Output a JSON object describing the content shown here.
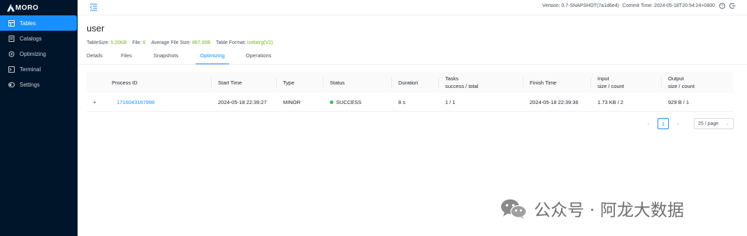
{
  "app": {
    "logo_text": "MORO"
  },
  "sidebar": {
    "items": [
      {
        "label": "Tables",
        "icon": "table-icon",
        "active": true
      },
      {
        "label": "Catalogs",
        "icon": "catalog-icon",
        "active": false
      },
      {
        "label": "Optimizing",
        "icon": "optimizing-icon",
        "active": false
      },
      {
        "label": "Terminal",
        "icon": "terminal-icon",
        "active": false
      },
      {
        "label": "Settings",
        "icon": "settings-icon",
        "active": false
      }
    ]
  },
  "header": {
    "version_label": "Version: 0.7-SNAPSHOT(7a1d6e4)",
    "commit_label": "Commit Time: 2024-05-18T20:54:24+0800"
  },
  "page": {
    "title": "user",
    "meta": {
      "table_size_label": "TableSize:",
      "table_size_value": "5.20KB",
      "file_label": "File:",
      "file_value": "6",
      "avg_file_size_label": "Average File Size:",
      "avg_file_size_value": "887.00B",
      "table_format_label": "Table Format:",
      "table_format_value": "Iceberg(V2)"
    },
    "tabs": [
      {
        "label": "Details",
        "active": false
      },
      {
        "label": "Files",
        "active": false
      },
      {
        "label": "Snapshots",
        "active": false
      },
      {
        "label": "Optimizing",
        "active": true
      },
      {
        "label": "Operations",
        "active": false
      }
    ]
  },
  "table": {
    "columns": {
      "process_id": "Process ID",
      "start_time": "Start Time",
      "type": "Type",
      "status": "Status",
      "duration": "Duration",
      "tasks_line1": "Tasks",
      "tasks_line2": "success / total",
      "finish_time": "Finish Time",
      "input_line1": "Input",
      "input_line2": "size / count",
      "output_line1": "Output",
      "output_line2": "size / count"
    },
    "rows": [
      {
        "expand": "+",
        "process_id": "1716043167998",
        "start_time": "2024-05-18 22:39:27",
        "type": "MINOR",
        "status": "SUCCESS",
        "status_color": "#2fc25b",
        "duration": "8 s",
        "tasks": "1 / 1",
        "finish_time": "2024-05-18 22:39:36",
        "input": "1.73 KB / 2",
        "output": "929 B / 1"
      }
    ]
  },
  "pagination": {
    "current_page": "1",
    "page_size": "25 / page"
  },
  "watermark": {
    "text": "公众号 · 阿龙大数据"
  },
  "colors": {
    "sidebar_bg": "#001529",
    "accent": "#1890ff",
    "meta_value": "#7ab317",
    "success": "#2fc25b"
  }
}
